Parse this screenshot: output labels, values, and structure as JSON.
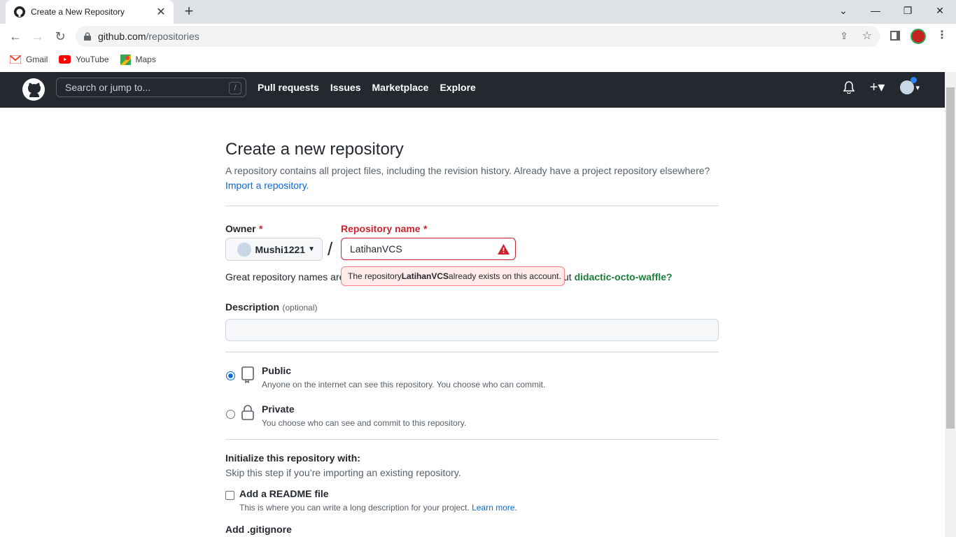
{
  "browser": {
    "tab_title": "Create a New Repository",
    "url_main": "github.com",
    "url_path": "/repositories",
    "bookmarks": [
      "Gmail",
      "YouTube",
      "Maps"
    ]
  },
  "header": {
    "search_placeholder": "Search or jump to...",
    "slash_key": "/",
    "nav": [
      "Pull requests",
      "Issues",
      "Marketplace",
      "Explore"
    ]
  },
  "page": {
    "title": "Create a new repository",
    "subtitle": "A repository contains all project files, including the revision history. Already have a project repository elsewhere?",
    "import_link": "Import a repository.",
    "owner_label": "Owner",
    "required_mark": "*",
    "owner_value": "Mushi1221",
    "separator": "/",
    "repo_label": "Repository name",
    "repo_value": "LatihanVCS",
    "hint_prefix": "Great repository names are",
    "hint_suffix_partial": "ut",
    "suggestion": "didactic-octo-waffle?",
    "error_text_pre": "The repository ",
    "error_repo": "LatihanVCS",
    "error_text_post": " already exists on this account.",
    "description_label": "Description",
    "description_optional": "(optional)",
    "public_label": "Public",
    "public_desc": "Anyone on the internet can see this repository. You choose who can commit.",
    "private_label": "Private",
    "private_desc": "You choose who can see and commit to this repository.",
    "init_title": "Initialize this repository with:",
    "init_sub": "Skip this step if you’re importing an existing repository.",
    "readme_label": "Add a README file",
    "readme_desc": "This is where you can write a long description for your project.",
    "learn_more": "Learn more.",
    "gitignore_label": "Add .gitignore"
  },
  "colors": {
    "header_bg": "#24292f",
    "accent": "#0969da",
    "danger": "#cf222e",
    "success": "#1a7f37"
  }
}
